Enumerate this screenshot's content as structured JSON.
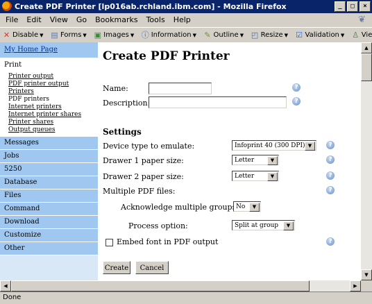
{
  "window": {
    "title": "Create PDF Printer [lp016ab.rchland.ibm.com] - Mozilla Firefox",
    "min": "_",
    "max": "□",
    "close": "×"
  },
  "menubar": [
    "File",
    "Edit",
    "View",
    "Go",
    "Bookmarks",
    "Tools",
    "Help"
  ],
  "toolbar": {
    "items": [
      {
        "label": "Disable",
        "icon": "disable-icon"
      },
      {
        "label": "Forms",
        "icon": "forms-icon"
      },
      {
        "label": "Images",
        "icon": "images-icon"
      },
      {
        "label": "Information",
        "icon": "info-icon"
      },
      {
        "label": "Outline",
        "icon": "outline-icon"
      },
      {
        "label": "Resize",
        "icon": "resize-icon"
      },
      {
        "label": "Validation",
        "icon": "validation-icon"
      },
      {
        "label": "View Source",
        "icon": "view-source-icon"
      }
    ]
  },
  "sidebar": {
    "home": "My Home Page",
    "print": "Print",
    "print_items": [
      "Printer output",
      "PDF printer output",
      "Printers",
      "PDF printers",
      "Internet printers",
      "Internet printer shares",
      "Printer shares",
      "Output queues"
    ],
    "sections": [
      "Messages",
      "Jobs",
      "5250",
      "Database",
      "Files",
      "Command",
      "Download",
      "Customize",
      "Other"
    ]
  },
  "main": {
    "title": "Create PDF Printer",
    "name_label": "Name:",
    "name_value": "",
    "description_label": "Description:",
    "description_value": "",
    "settings_heading": "Settings",
    "device_label": "Device type to emulate:",
    "device_value": "Infoprint 40 (300 DPI)",
    "drawer1_label": "Drawer 1 paper size:",
    "drawer1_value": "Letter",
    "drawer2_label": "Drawer 2 paper size:",
    "drawer2_value": "Letter",
    "multiple_label": "Multiple PDF files:",
    "ack_label": "Acknowledge multiple groups:",
    "ack_value": "No",
    "process_label": "Process option:",
    "process_value": "Split at group",
    "embed_label": "Embed font in PDF output",
    "embed_checked": false,
    "create_button": "Create",
    "cancel_button": "Cancel",
    "help_glyph": "?"
  },
  "status": {
    "text": "Done"
  },
  "colors": {
    "title_bar": "#0a246a",
    "sidebar_tab": "#9fc7ef",
    "sidebar_bg": "#d9e8f7",
    "link": "#00339f"
  }
}
